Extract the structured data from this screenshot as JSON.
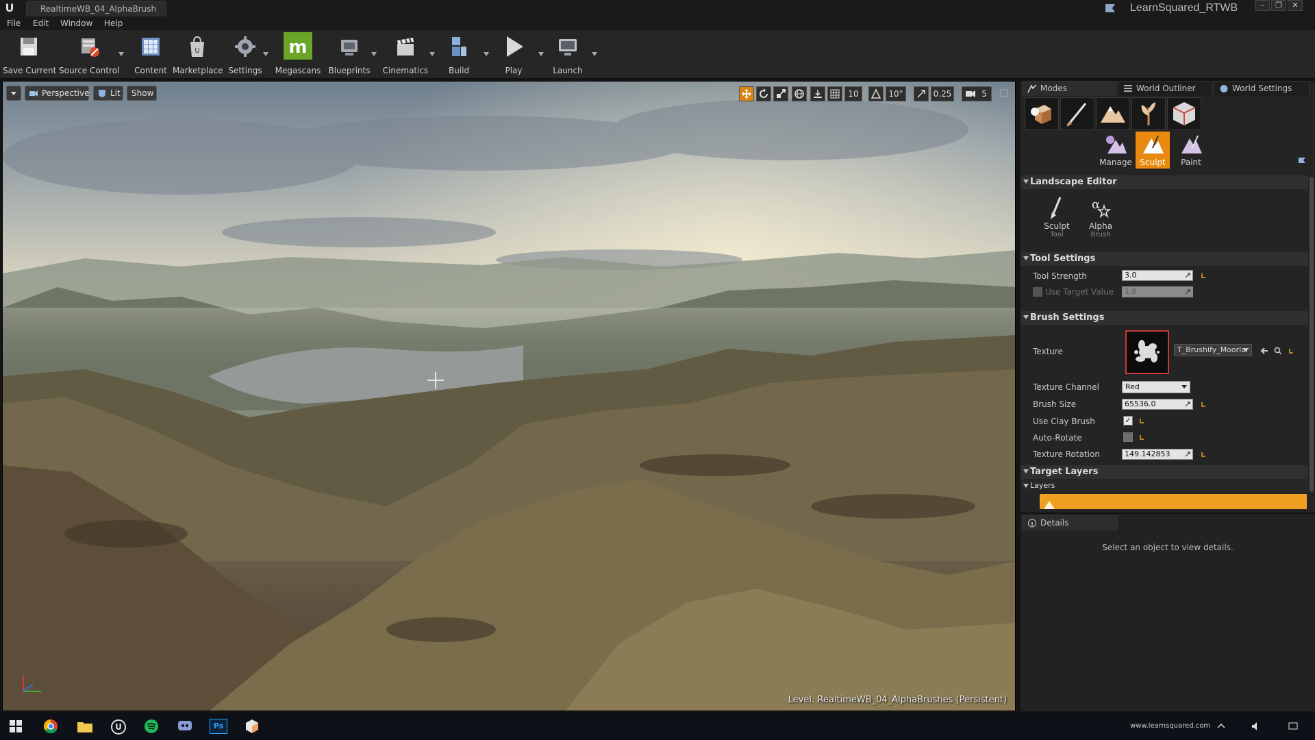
{
  "window": {
    "tab_title": "RealtimeWB_04_AlphaBrush",
    "project_name": "LearnSquared_RTWB",
    "controls": [
      "–",
      "❐",
      "✕"
    ]
  },
  "menu": [
    "File",
    "Edit",
    "Window",
    "Help"
  ],
  "toolbar": {
    "save_current": "Save Current",
    "source_control": "Source Control",
    "content": "Content",
    "marketplace": "Marketplace",
    "settings": "Settings",
    "megascans": "Megascans",
    "blueprints": "Blueprints",
    "cinematics": "Cinematics",
    "build": "Build",
    "play": "Play",
    "launch": "Launch"
  },
  "viewport": {
    "perspective": "Perspective",
    "lit": "Lit",
    "show": "Show",
    "grid_snap": "10",
    "rotation_snap": "10°",
    "scale_snap": "0.25",
    "camera_speed": "5",
    "level_label": "Level:",
    "level_name": "RealtimeWB_04_AlphaBrushes (Persistent)"
  },
  "panel": {
    "tabs": [
      "Modes",
      "World Outliner",
      "World Settings"
    ],
    "sub_modes": [
      "Manage",
      "Sculpt",
      "Paint"
    ],
    "landscape_editor": "Landscape Editor",
    "tools": [
      {
        "label": "Sculpt",
        "sub": "Tool"
      },
      {
        "label": "Alpha",
        "sub": "Brush"
      }
    ],
    "tool_settings": {
      "header": "Tool Settings",
      "tool_strength_label": "Tool Strength",
      "tool_strength": "3.0",
      "use_target_value_label": "Use Target Value",
      "target_value": "1.0"
    },
    "brush_settings": {
      "header": "Brush Settings",
      "texture_label": "Texture",
      "texture_name": "T_Brushify_Moorlar",
      "texture_channel_label": "Texture Channel",
      "texture_channel": "Red",
      "brush_size_label": "Brush Size",
      "brush_size": "65536.0",
      "use_clay_brush_label": "Use Clay Brush",
      "auto_rotate_label": "Auto-Rotate",
      "texture_rotation_label": "Texture Rotation",
      "texture_rotation": "149.142853"
    },
    "target_layers": {
      "header": "Target Layers",
      "layers_label": "Layers"
    },
    "details": {
      "tab": "Details",
      "empty_message": "Select an object to view details."
    }
  },
  "taskbar": {
    "url_text": "www.learnsquared.com"
  },
  "colors": {
    "accent_orange": "#e88a10",
    "megascans_green": "#6aa52a",
    "panel_bg": "#242424"
  }
}
